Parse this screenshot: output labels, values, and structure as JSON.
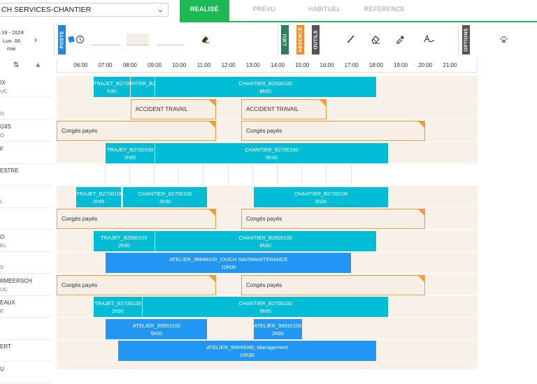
{
  "header": {
    "service_select": "CH SERVICES-CHANTIER",
    "tabs": [
      {
        "label": "REALISÉ",
        "active": true
      },
      {
        "label": "PRÉVU",
        "active": false
      },
      {
        "label": "HABITUEL",
        "active": false
      },
      {
        "label": "RÉFÉRENCE",
        "active": false
      }
    ]
  },
  "toolbar": {
    "date_line1": ".19 - 2024",
    "date_line2": "Lun. 06",
    "date_line3": "mai",
    "next_icon": "chevron-right-icon",
    "poste_label": "POSTE",
    "lieu_label": "LIEU",
    "absence_label": "ABSENCE",
    "outils_label": "OUTILS",
    "options_label": "OPTIONS",
    "colors": {
      "poste": "#1e88e5",
      "lieu": "#2e7d5b",
      "absence": "#f28c28",
      "outils": "#555555",
      "options": "#555555"
    },
    "icons": [
      "sticker-icon",
      "clock-icon",
      "eraser-chip-icon",
      "brush-icon",
      "eraser-icon",
      "eyedropper-icon",
      "signature-icon",
      "paw-icon"
    ]
  },
  "timeline": {
    "hours": [
      "06:00",
      "07:00",
      "08:00",
      "09:00",
      "10:00",
      "11:00",
      "12:00",
      "13:00",
      "14:00",
      "15:00",
      "16:00",
      "17:00",
      "18:00",
      "19:00",
      "20:00",
      "21:00"
    ]
  },
  "people": [
    {
      "name": "IX",
      "sub": "UC"
    },
    {
      "name": "",
      "sub": "O"
    },
    {
      "name": "GIIS",
      "sub": "O"
    },
    {
      "name": "F",
      "sub": ""
    },
    {
      "name": "ESTRE",
      "sub": ""
    },
    {
      "name": "",
      "sub": "L"
    },
    {
      "name": "",
      "sub": ""
    },
    {
      "name": "O",
      "sub": "EL"
    },
    {
      "name": "",
      "sub": "S"
    },
    {
      "name": "RMEERSCH",
      "sub": "UC"
    },
    {
      "name": "EAUX",
      "sub": "E"
    },
    {
      "name": "",
      "sub": ""
    },
    {
      "name": "ERT",
      "sub": ""
    },
    {
      "name": "U",
      "sub": ""
    }
  ],
  "rows": [
    {
      "white": false,
      "blocks": [
        {
          "kind": "cyan",
          "t1": "TRAJET_B2700100",
          "t2": "h30",
          "start": 6.55,
          "end": 8.05
        },
        {
          "kind": "cyan",
          "t1": "NTIER_B2",
          "t2": "",
          "start": 8.05,
          "end": 9.05
        },
        {
          "kind": "cyan",
          "t1": "CHANTIER_B2500100",
          "t2": "8h00",
          "start": 9.05,
          "end": 18.05
        }
      ]
    },
    {
      "white": false,
      "blocks": [
        {
          "kind": "absence",
          "t1": "ACCIDENT TRAVAIL",
          "t2": "",
          "start": 8.05,
          "end": 11.55
        },
        {
          "kind": "absence",
          "t1": "ACCIDENT TRAVAIL",
          "t2": "",
          "start": 12.55,
          "end": 16.05
        }
      ]
    },
    {
      "white": false,
      "blocks": [
        {
          "kind": "absence",
          "t1": "Congés payés",
          "t2": "",
          "start": 5.05,
          "end": 11.55
        },
        {
          "kind": "absence",
          "t1": "Congés payés",
          "t2": "",
          "start": 12.55,
          "end": 20.05
        }
      ]
    },
    {
      "white": false,
      "blocks": [
        {
          "kind": "cyan",
          "t1": "TRAJET_B2700100",
          "t2": "2h00",
          "start": 7.05,
          "end": 9.05
        },
        {
          "kind": "cyan",
          "t1": "CHANTIER_B2700100",
          "t2": "8h30",
          "start": 9.05,
          "end": 18.55
        }
      ]
    },
    {
      "white": true,
      "blocks": []
    },
    {
      "white": false,
      "blocks": [
        {
          "kind": "cyan",
          "t1": "TRAJET_B2700100",
          "t2": "2h45",
          "start": 5.85,
          "end": 7.7
        },
        {
          "kind": "cyan",
          "t1": "CHANTIER_B2700100",
          "t2": "3h30",
          "start": 7.75,
          "end": 11.2
        },
        {
          "kind": "cyan",
          "t1": "CHANTIER_B2700100",
          "t2": "5h30",
          "start": 13.05,
          "end": 18.55
        }
      ]
    },
    {
      "white": false,
      "blocks": [
        {
          "kind": "absence",
          "t1": "Congés payés",
          "t2": "",
          "start": 5.05,
          "end": 11.55
        },
        {
          "kind": "absence",
          "t1": "Congés payés",
          "t2": "",
          "start": 12.55,
          "end": 20.05
        }
      ]
    },
    {
      "white": false,
      "blocks": [
        {
          "kind": "cyan",
          "t1": "TRAJET_B2500100",
          "t2": "2h30",
          "start": 6.55,
          "end": 9.05
        },
        {
          "kind": "cyan",
          "t1": "CHANTIER_B2500100",
          "t2": "8h30",
          "start": 9.05,
          "end": 18.05
        }
      ]
    },
    {
      "white": false,
      "blocks": [
        {
          "kind": "blue",
          "t1": "ATELIER_99949100_CIUCH SAV/MAINTENANCE",
          "t2": "10h00",
          "start": 7.05,
          "end": 17.05
        }
      ]
    },
    {
      "white": false,
      "blocks": [
        {
          "kind": "absence",
          "t1": "Congés payés",
          "t2": "",
          "start": 5.05,
          "end": 11.55
        },
        {
          "kind": "absence",
          "t1": "Congés payés",
          "t2": "",
          "start": 12.55,
          "end": 20.05
        }
      ]
    },
    {
      "white": false,
      "blocks": [
        {
          "kind": "cyan",
          "t1": "TRAJET_B2700100",
          "t2": "2h00",
          "start": 6.55,
          "end": 8.55
        },
        {
          "kind": "cyan",
          "t1": "CHANTIER_B2700100",
          "t2": "9h00",
          "start": 8.55,
          "end": 18.55
        }
      ]
    },
    {
      "white": false,
      "blocks": [
        {
          "kind": "blue",
          "t1": "ATELIER_99932100",
          "t2": "5h00",
          "start": 7.05,
          "end": 11.2
        },
        {
          "kind": "blue",
          "t1": "ATELIER_99932100",
          "t2": "2h00",
          "start": 13.05,
          "end": 15.05
        }
      ]
    },
    {
      "white": false,
      "blocks": [
        {
          "kind": "blue",
          "t1": "ATELIER_99949000_Management",
          "t2": "10h30",
          "start": 7.55,
          "end": 18.05
        }
      ]
    },
    {
      "white": false,
      "blocks": []
    }
  ]
}
